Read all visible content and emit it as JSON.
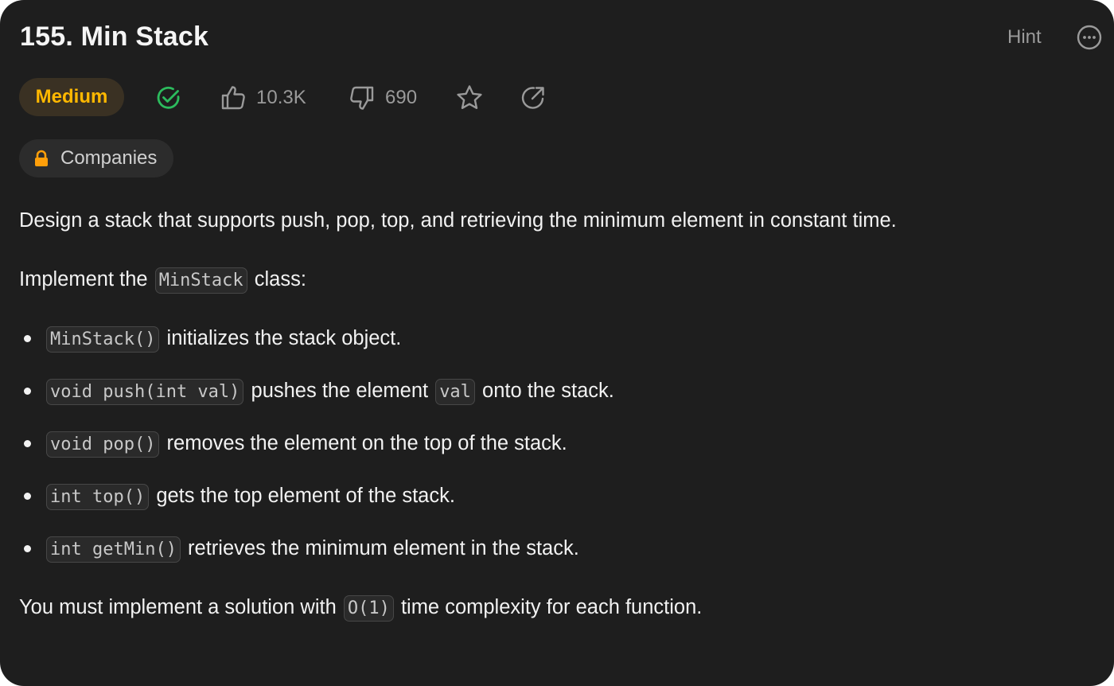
{
  "header": {
    "title": "155. Min Stack",
    "hint_label": "Hint",
    "more_icon": "more-horizontal-icon"
  },
  "meta": {
    "difficulty": "Medium",
    "difficulty_color": "#ffb800",
    "solved_icon": "check-circle-icon",
    "solved_color": "#2cbb5d",
    "likes": "10.3K",
    "dislikes": "690",
    "companies_label": "Companies",
    "lock_color": "#ff9f0a"
  },
  "description": {
    "intro": "Design a stack that supports push, pop, top, and retrieving the minimum element in constant time.",
    "implement_prefix": "Implement the",
    "implement_code": "MinStack",
    "implement_suffix": "class:",
    "items": [
      {
        "code": "MinStack()",
        "text": "initializes the stack object."
      },
      {
        "code": "void push(int val)",
        "text_before": "pushes the element",
        "code2": "val",
        "text_after": "onto the stack."
      },
      {
        "code": "void pop()",
        "text": "removes the element on the top of the stack."
      },
      {
        "code": "int top()",
        "text": "gets the top element of the stack."
      },
      {
        "code": "int getMin()",
        "text": "retrieves the minimum element in the stack."
      }
    ],
    "complexity_prefix": "You must implement a solution with",
    "complexity_code": "O(1)",
    "complexity_suffix": "time complexity for each function."
  }
}
